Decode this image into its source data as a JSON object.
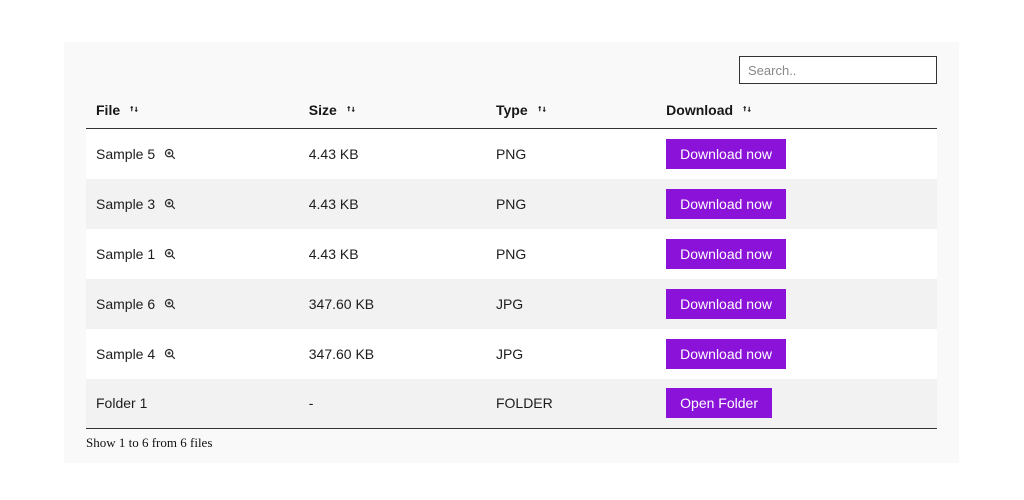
{
  "search": {
    "placeholder": "Search.."
  },
  "columns": {
    "file": "File",
    "size": "Size",
    "type": "Type",
    "download": "Download"
  },
  "rows": [
    {
      "file": "Sample 5",
      "size": "4.43 KB",
      "type": "PNG",
      "action": "Download now"
    },
    {
      "file": "Sample 3",
      "size": "4.43 KB",
      "type": "PNG",
      "action": "Download now"
    },
    {
      "file": "Sample 1",
      "size": "4.43 KB",
      "type": "PNG",
      "action": "Download now"
    },
    {
      "file": "Sample 6",
      "size": "347.60 KB",
      "type": "JPG",
      "action": "Download now"
    },
    {
      "file": "Sample 4",
      "size": "347.60 KB",
      "type": "JPG",
      "action": "Download now"
    },
    {
      "file": "Folder 1",
      "size": "-",
      "type": "FOLDER",
      "action": "Open Folder"
    }
  ],
  "footer": "Show 1 to 6 from 6 files"
}
